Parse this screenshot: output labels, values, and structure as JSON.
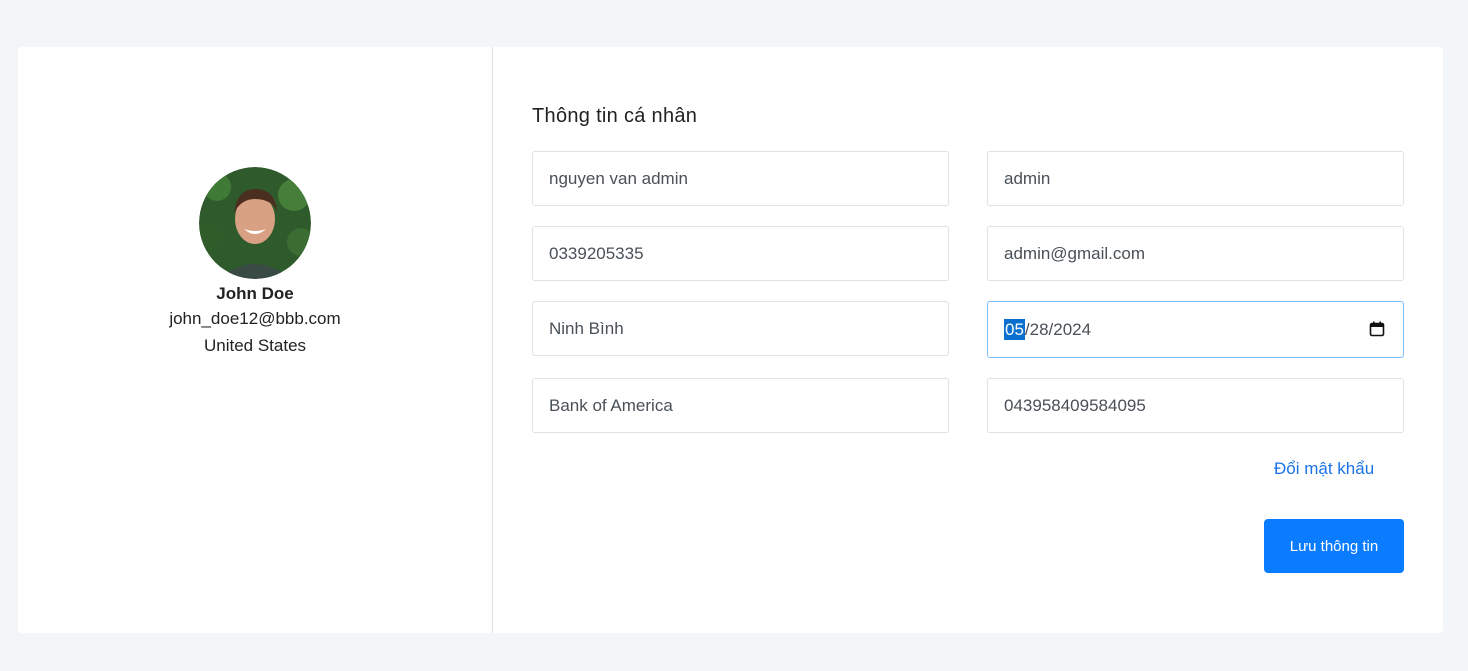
{
  "profile": {
    "name": "John Doe",
    "email": "john_doe12@bbb.com",
    "country": "United States"
  },
  "form": {
    "title": "Thông tin cá nhân",
    "full_name": "nguyen van admin",
    "username": "admin",
    "phone": "0339205335",
    "email": "admin@gmail.com",
    "address": "Ninh Bình",
    "date": {
      "month": "05",
      "rest": "/28/2024"
    },
    "bank_name": "Bank of America",
    "account_number": "043958409584095"
  },
  "actions": {
    "change_password": "Đổi mật khẩu",
    "save": "Lưu thông tin"
  },
  "colors": {
    "accent": "#0a7cff",
    "link": "#1a73e8",
    "background": "#f3f6f9"
  },
  "icons": {
    "date_picker": "calendar-icon"
  }
}
